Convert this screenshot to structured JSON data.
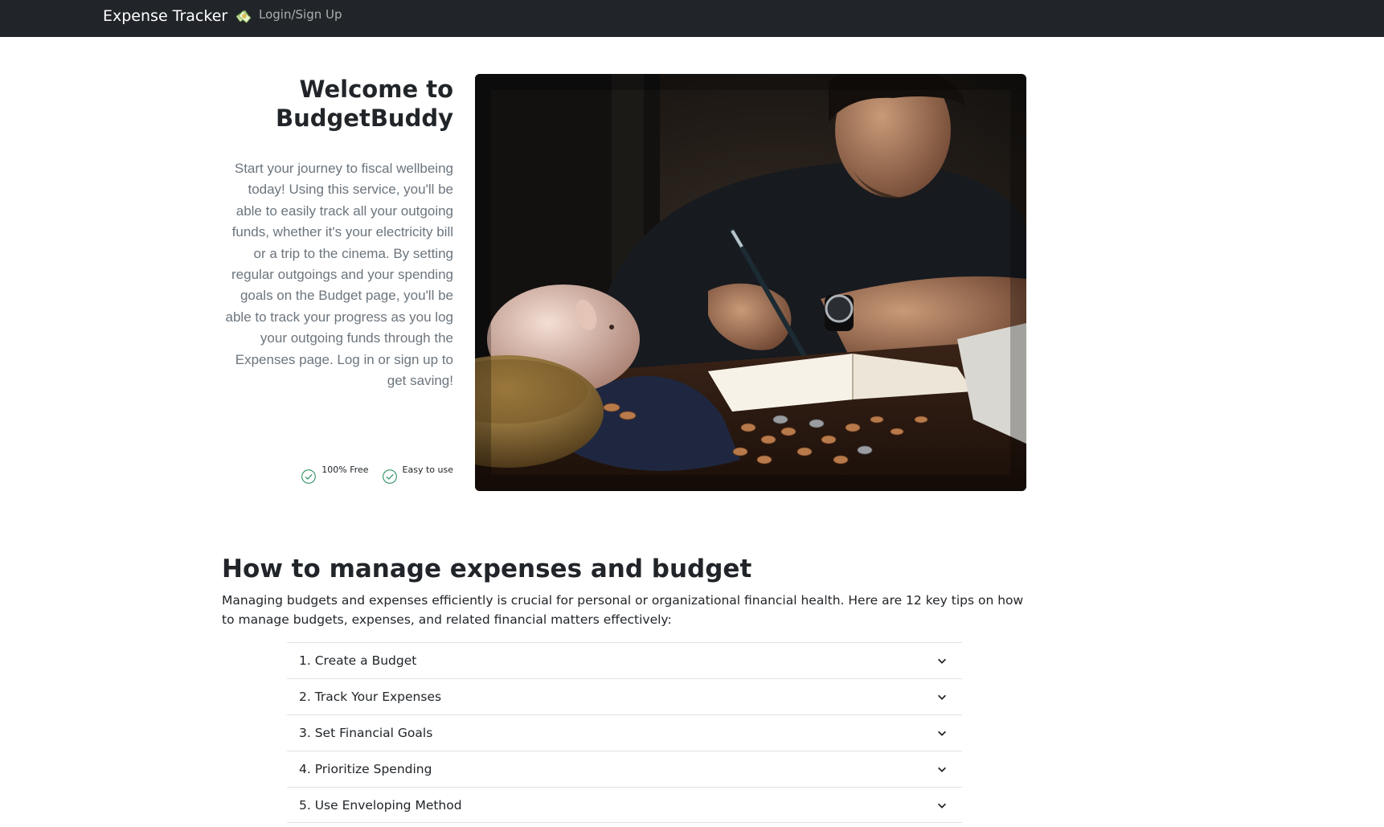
{
  "navbar": {
    "brand": "Expense Tracker",
    "brand_icon": "money-icon",
    "login_link": "Login/Sign Up"
  },
  "hero": {
    "title": "Welcome to BudgetBuddy",
    "text": "Start your journey to fiscal wellbeing today! Using this service, you'll be able to easily track all your outgoing funds, whether it's your electricity bill or a trip to the cinema. By setting regular outgoings and your spending goals on the Budget page, you'll be able to track your progress as you log your outgoing funds through the Expenses page. Log in or sign up to get saving!",
    "features": [
      {
        "label": "100% Free",
        "icon": "check-circle-icon"
      },
      {
        "label": "Easy to use",
        "icon": "check-circle-icon"
      }
    ]
  },
  "tips": {
    "title": "How to manage expenses and budget",
    "intro": "Managing budgets and expenses efficiently is crucial for personal or organizational financial health. Here are 12 key tips on how to manage budgets, expenses, and related financial matters effectively:",
    "items": [
      {
        "label": "1. Create a Budget"
      },
      {
        "label": "2. Track Your Expenses"
      },
      {
        "label": "3. Set Financial Goals"
      },
      {
        "label": "4. Prioritize Spending"
      },
      {
        "label": "5. Use Enveloping Method"
      }
    ]
  },
  "colors": {
    "navbar_bg": "#212529",
    "check_green": "#198754",
    "muted_text": "#6c757d"
  }
}
